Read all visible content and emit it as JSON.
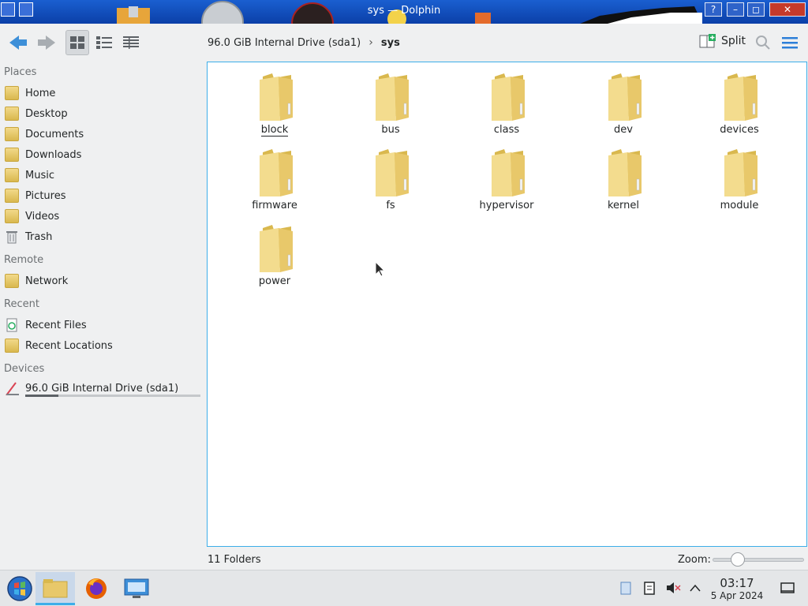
{
  "window": {
    "title": "sys — Dolphin",
    "buttons": [
      "?",
      "–",
      "◻",
      "✕"
    ]
  },
  "toolbar": {
    "split_label": "Split"
  },
  "breadcrumb": {
    "segments": [
      "96.0 GiB Internal Drive (sda1)",
      "sys"
    ],
    "separator": "›"
  },
  "sidebar": {
    "sections": {
      "places": "Places",
      "remote": "Remote",
      "recent": "Recent",
      "devices": "Devices"
    },
    "places": [
      {
        "label": "Home",
        "icon": "home-folder-icon"
      },
      {
        "label": "Desktop",
        "icon": "desktop-icon"
      },
      {
        "label": "Documents",
        "icon": "documents-icon"
      },
      {
        "label": "Downloads",
        "icon": "downloads-icon"
      },
      {
        "label": "Music",
        "icon": "music-icon"
      },
      {
        "label": "Pictures",
        "icon": "pictures-icon"
      },
      {
        "label": "Videos",
        "icon": "videos-icon"
      },
      {
        "label": "Trash",
        "icon": "trash-icon"
      }
    ],
    "remote": [
      {
        "label": "Network",
        "icon": "network-icon"
      }
    ],
    "recent": [
      {
        "label": "Recent Files",
        "icon": "recent-files-icon"
      },
      {
        "label": "Recent Locations",
        "icon": "recent-locations-icon"
      }
    ],
    "devices": [
      {
        "label": "96.0 GiB Internal Drive (sda1)",
        "icon": "drive-icon",
        "usage": 0.19
      }
    ]
  },
  "folders": [
    "block",
    "bus",
    "class",
    "dev",
    "devices",
    "firmware",
    "fs",
    "hypervisor",
    "kernel",
    "module",
    "power"
  ],
  "status": {
    "count": "11 Folders",
    "zoom_label": "Zoom:",
    "zoom_level": 0.28
  },
  "taskbar": {
    "time": "03:17",
    "date": "5 Apr 2024"
  },
  "colors": {
    "accent": "#3daee9",
    "titlebar": "#1a5fd0",
    "folder": "#e8c86a"
  }
}
